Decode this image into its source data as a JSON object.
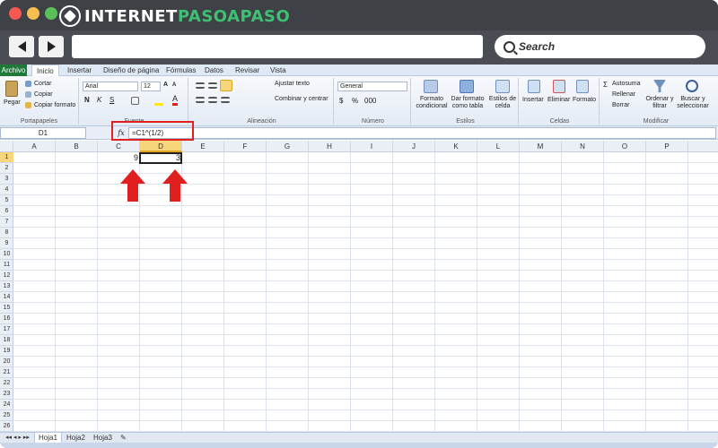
{
  "site": {
    "brand_white": "INTERNET",
    "brand_green": "PASOAPASO"
  },
  "browser": {
    "search_label": "Search"
  },
  "ribbon": {
    "tabs": [
      "Archivo",
      "Inicio",
      "Insertar",
      "Diseño de página",
      "Fórmulas",
      "Datos",
      "Revisar",
      "Vista"
    ],
    "clipboard": {
      "paste": "Pegar",
      "cut": "Cortar",
      "copy": "Copiar",
      "format_painter": "Copiar formato",
      "label": "Portapapeles"
    },
    "font": {
      "name": "Arial",
      "size": "12",
      "bold": "N",
      "italic": "K",
      "underline": "S",
      "label": "Fuente"
    },
    "alignment": {
      "wrap": "Ajustar texto",
      "merge": "Combinar y centrar",
      "label": "Alineación"
    },
    "number": {
      "format": "General",
      "label": "Número"
    },
    "styles": {
      "conditional": "Formato condicional",
      "table": "Dar formato como tabla",
      "cell_styles": "Estilos de celda",
      "label": "Estilos"
    },
    "cells": {
      "insert": "Insertar",
      "delete": "Eliminar",
      "format": "Formato",
      "label": "Celdas"
    },
    "editing": {
      "autosum": "Autosuma",
      "fill": "Rellenar",
      "clear": "Borrar",
      "sort": "Ordenar y filtrar",
      "find": "Buscar y seleccionar",
      "label": "Modificar"
    }
  },
  "formula_bar": {
    "name_box": "D1",
    "fx": "fx",
    "formula": "=C1^(1/2)"
  },
  "grid": {
    "columns": [
      "A",
      "B",
      "C",
      "D",
      "E",
      "F",
      "G",
      "H",
      "I",
      "J",
      "K",
      "L",
      "M",
      "N",
      "O",
      "P"
    ],
    "rows": [
      "1",
      "2",
      "3",
      "4",
      "5",
      "6",
      "7",
      "8",
      "9",
      "10",
      "11",
      "12",
      "13",
      "14",
      "15",
      "16",
      "17",
      "18",
      "19",
      "20",
      "21",
      "22",
      "23",
      "24",
      "25",
      "26"
    ],
    "selected_col": "D",
    "selected_row": "1",
    "cells": {
      "C1": "9",
      "D1": "3"
    }
  },
  "sheets": [
    "Hoja1",
    "Hoja2",
    "Hoja3"
  ],
  "colors": {
    "excel_green": "#1f7a3a",
    "highlight_red": "#e0201f",
    "selection_yellow": "#f7d67b",
    "brand_green": "#3fbf74"
  }
}
